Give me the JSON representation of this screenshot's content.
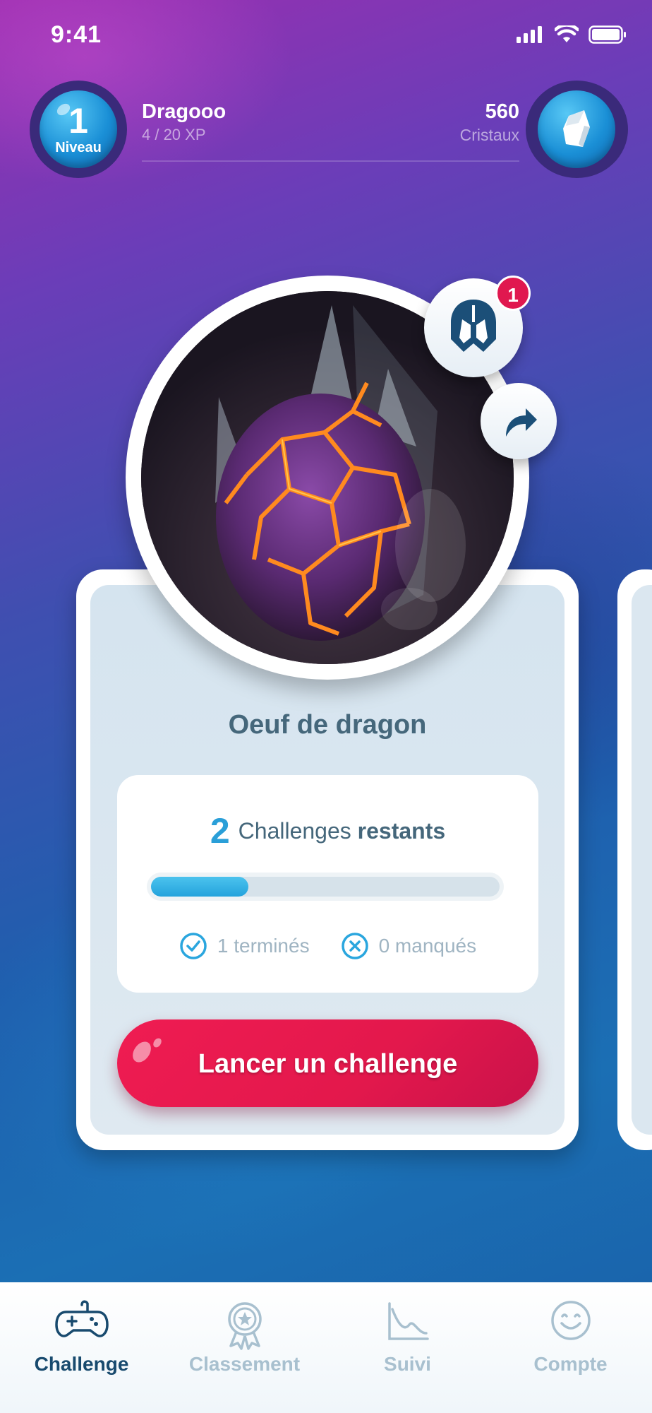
{
  "status_bar": {
    "time": "9:41"
  },
  "header": {
    "level_number": "1",
    "level_label": "Niveau",
    "username": "Dragooo",
    "xp": "4 / 20 XP",
    "crystal_count": "560",
    "crystal_label": "Cristaux"
  },
  "hero_badge": {
    "count": "1"
  },
  "card": {
    "title": "Oeuf de dragon",
    "remaining_count": "2",
    "remaining_text": "Challenges",
    "remaining_strong": "restants",
    "progress_fraction": 0.28,
    "completed": "1 terminés",
    "missed": "0 manqués",
    "launch_label": "Lancer un challenge"
  },
  "tabs": [
    {
      "label": "Challenge",
      "icon": "gamepad-icon",
      "active": true
    },
    {
      "label": "Classement",
      "icon": "award-icon",
      "active": false
    },
    {
      "label": "Suivi",
      "icon": "chart-icon",
      "active": false
    },
    {
      "label": "Compte",
      "icon": "smiley-icon",
      "active": false
    }
  ],
  "colors": {
    "accent": "#e3184c",
    "progress": "#2aa6de",
    "active_tab": "#184a6e",
    "inactive_tab": "#a8c0cf"
  }
}
